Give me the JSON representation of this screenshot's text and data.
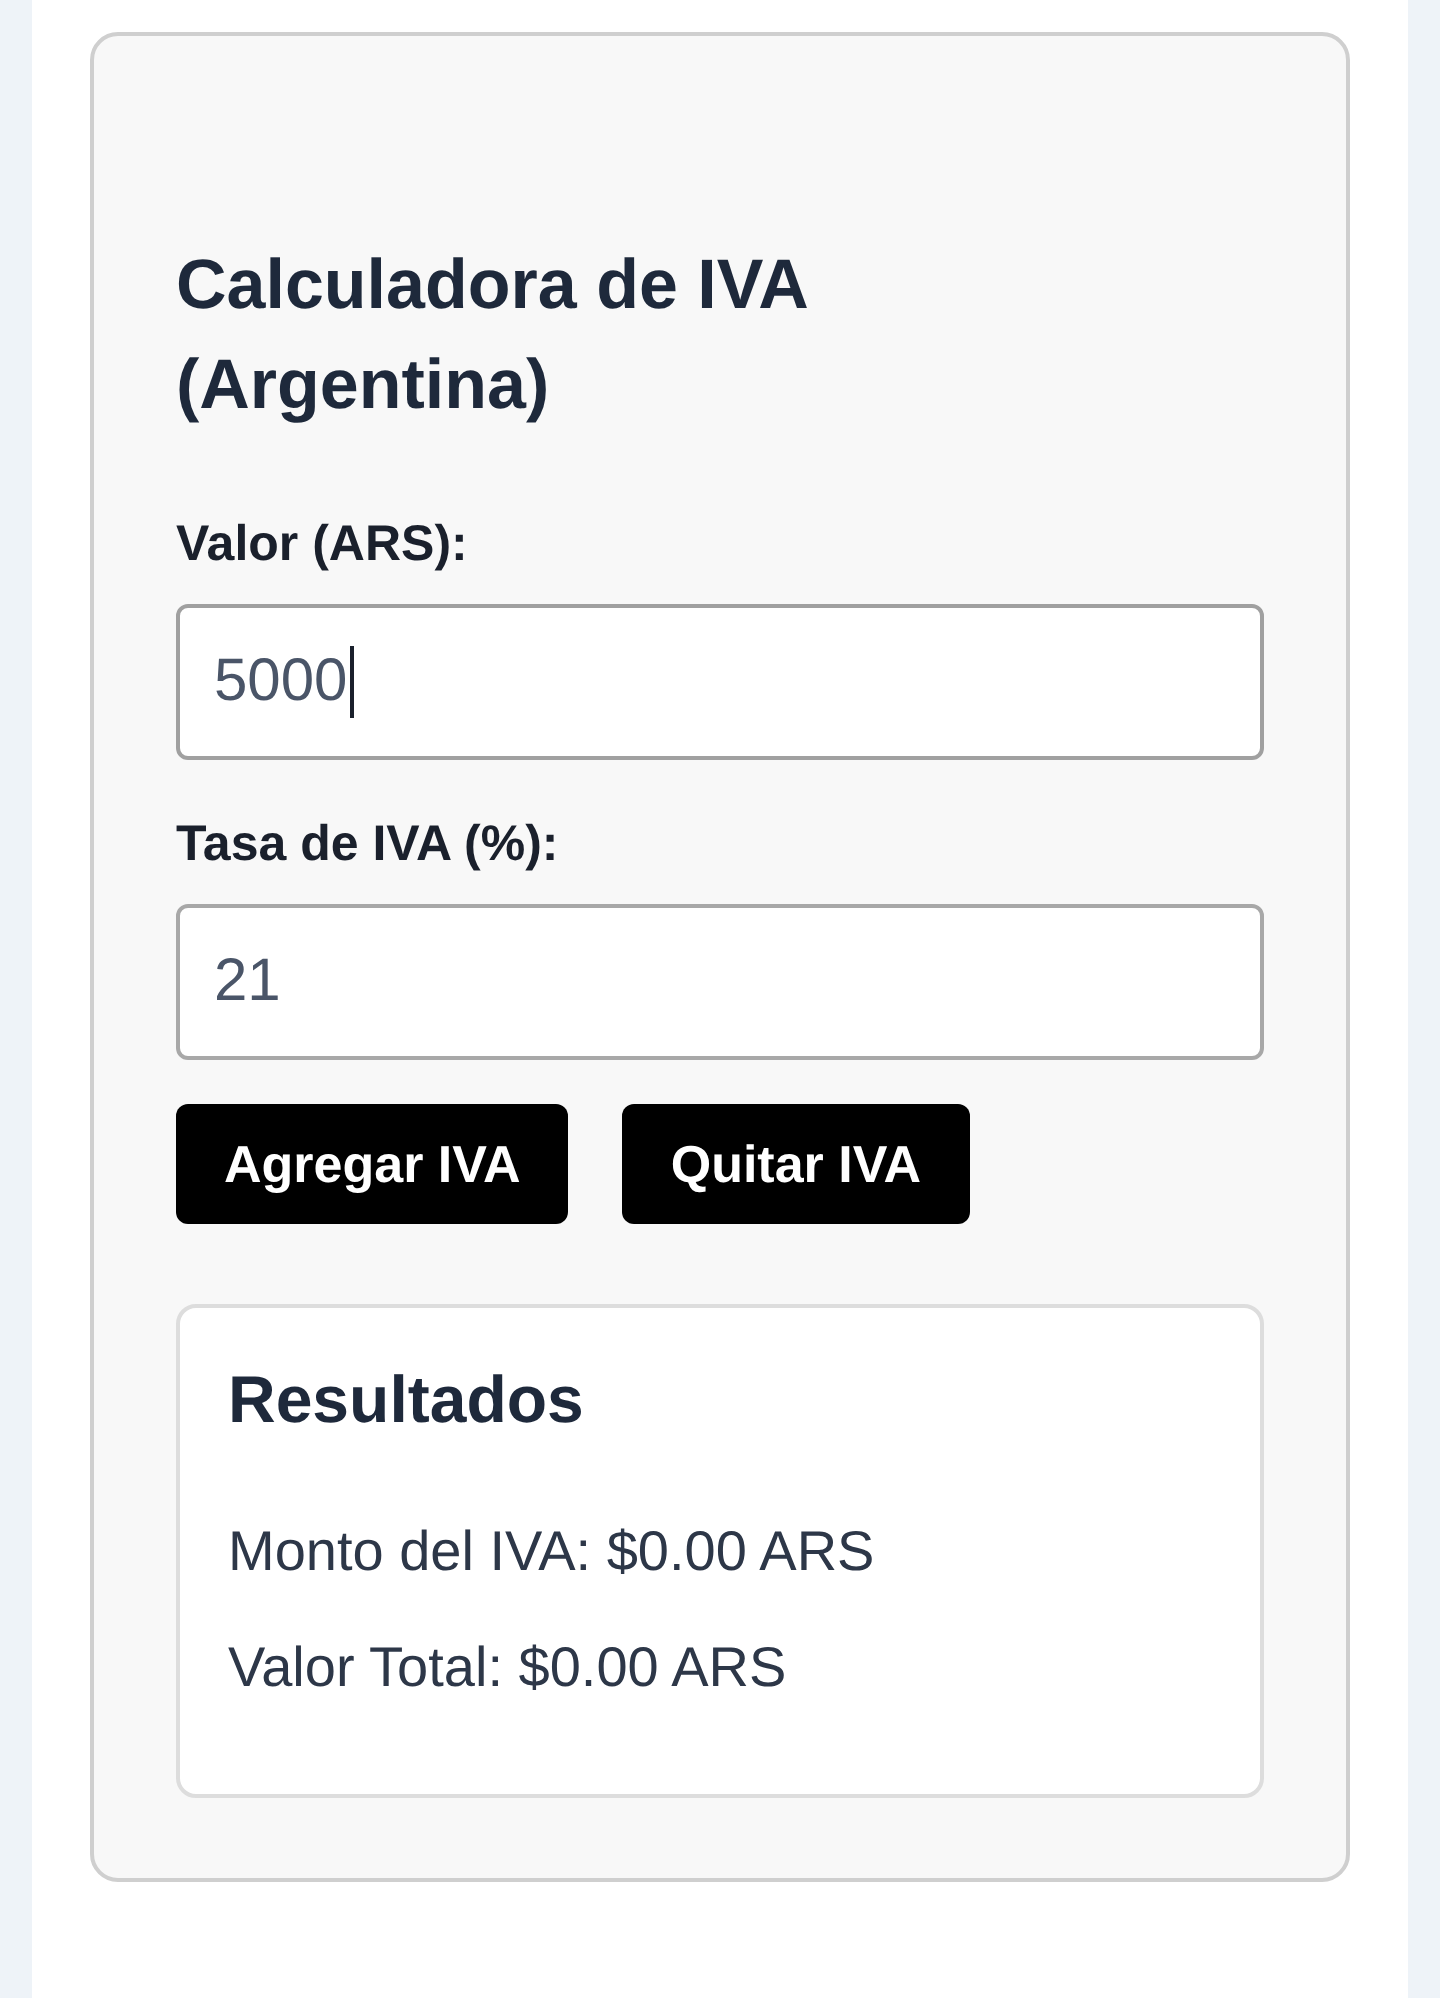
{
  "title": "Calculadora de IVA (Argentina)",
  "fields": [
    {
      "label": "Valor (ARS):",
      "value": "5000",
      "focused": true
    },
    {
      "label": "Tasa de IVA (%):",
      "value": "21",
      "focused": false
    }
  ],
  "buttons": [
    "Agregar IVA",
    "Quitar IVA"
  ],
  "results": {
    "title": "Resultados",
    "lines": [
      "Monto del IVA: $0.00 ARS",
      "Valor Total: $0.00 ARS"
    ]
  }
}
